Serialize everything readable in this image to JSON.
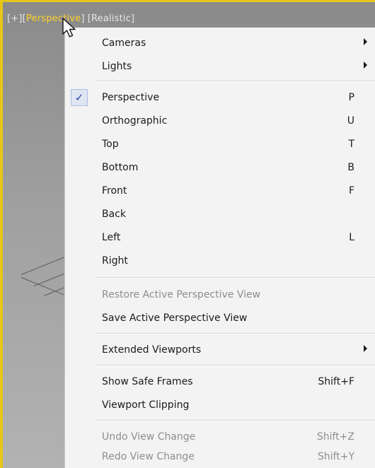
{
  "viewport_label": {
    "plus": "[+]",
    "view_open": "[",
    "view": "Perspective",
    "view_close": "]",
    "shading": "[Realistic]"
  },
  "colors": {
    "active_label": "#ffd12a",
    "viewport_border": "#e7c61a",
    "check_color": "#2a3fa8"
  },
  "menu": {
    "items": [
      {
        "label": "Cameras",
        "submenu": true
      },
      {
        "label": "Lights",
        "submenu": true
      },
      {
        "label": "Perspective",
        "shortcut": "P",
        "checked": true
      },
      {
        "label": "Orthographic",
        "shortcut": "U"
      },
      {
        "label": "Top",
        "shortcut": "T"
      },
      {
        "label": "Bottom",
        "shortcut": "B"
      },
      {
        "label": "Front",
        "shortcut": "F"
      },
      {
        "label": "Back"
      },
      {
        "label": "Left",
        "shortcut": "L"
      },
      {
        "label": "Right"
      },
      {
        "label": "Restore Active Perspective View",
        "disabled": true
      },
      {
        "label": "Save Active Perspective View"
      },
      {
        "label": "Extended Viewports",
        "submenu": true
      },
      {
        "label": "Show Safe Frames",
        "shortcut": "Shift+F"
      },
      {
        "label": "Viewport Clipping"
      },
      {
        "label": "Undo View Change",
        "shortcut": "Shift+Z",
        "disabled": true
      },
      {
        "label": "Redo View Change",
        "shortcut": "Shift+Y",
        "disabled": true
      }
    ],
    "check_glyph": "✓"
  }
}
